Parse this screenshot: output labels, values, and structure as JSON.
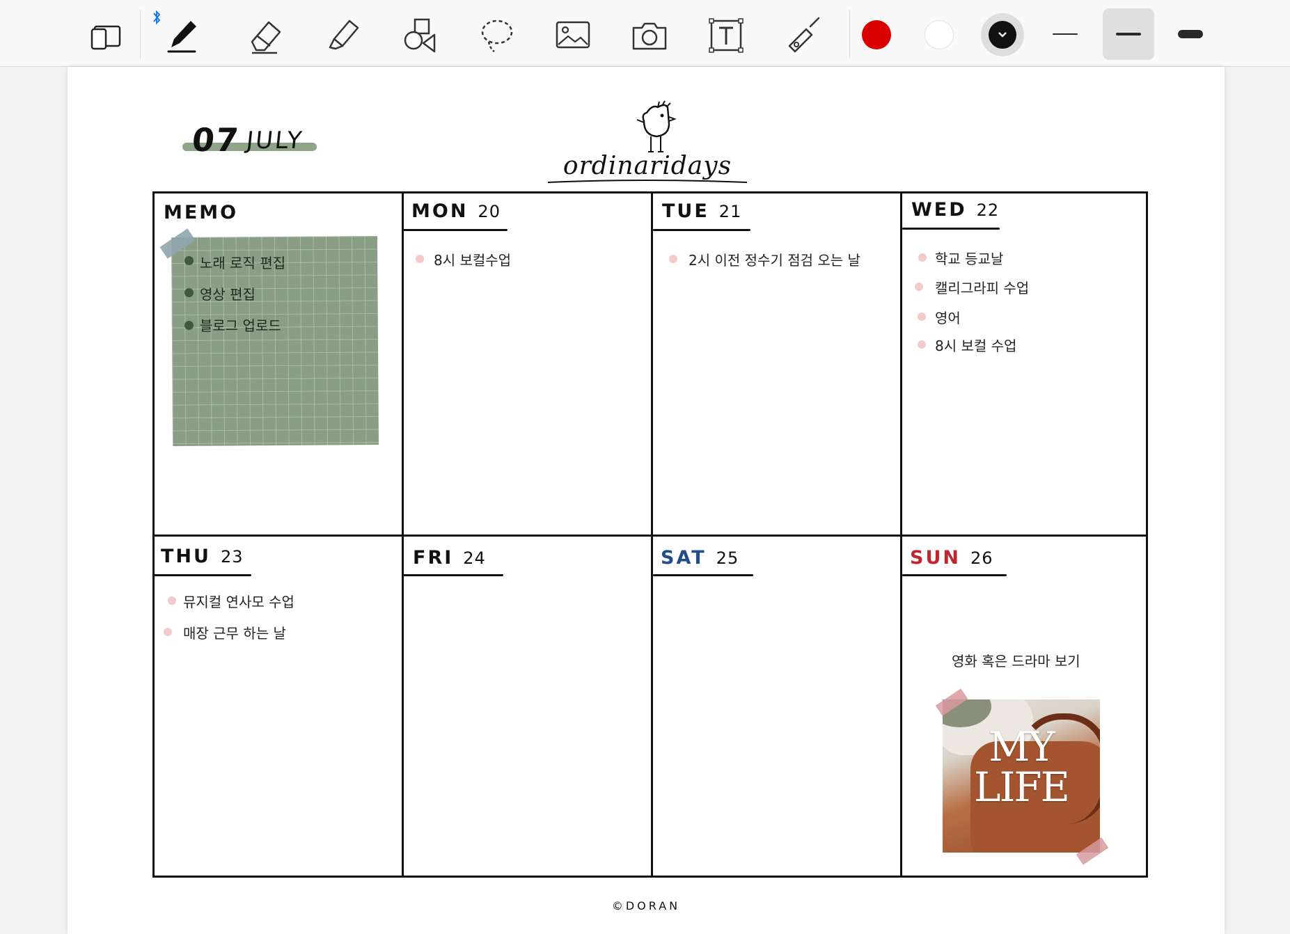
{
  "toolbar": {
    "tools": [
      {
        "id": "page-layout",
        "icon": "page-layout-icon"
      },
      {
        "id": "pen",
        "icon": "pen-icon"
      },
      {
        "id": "eraser",
        "icon": "eraser-icon"
      },
      {
        "id": "highlighter",
        "icon": "highlighter-icon"
      },
      {
        "id": "shapes",
        "icon": "shapes-icon"
      },
      {
        "id": "lasso",
        "icon": "lasso-icon"
      },
      {
        "id": "image",
        "icon": "image-icon"
      },
      {
        "id": "camera",
        "icon": "camera-icon"
      },
      {
        "id": "text",
        "icon": "text-box-icon"
      },
      {
        "id": "laser",
        "icon": "laser-pointer-icon"
      }
    ],
    "colors": [
      "#d90000",
      "#ffffff",
      "#111111"
    ],
    "selected_color": "#111111",
    "stroke_widths": [
      "thin",
      "medium",
      "thick"
    ],
    "selected_stroke": "medium"
  },
  "planner": {
    "date_number": "07",
    "date_month": "JULY",
    "brand": "ordinaridays",
    "credit": "©DORAN",
    "accent_color": "#8fa588",
    "memo": {
      "title": "MEMO",
      "items": [
        "노래 로직 편집",
        "영상 편집",
        "블로그 업로드"
      ]
    },
    "days": [
      {
        "key": "mon",
        "name": "MON",
        "num": "20",
        "color": "#111111",
        "tasks": [
          "8시 보컬수업"
        ]
      },
      {
        "key": "tue",
        "name": "TUE",
        "num": "21",
        "color": "#111111",
        "tasks": [
          "2시 이전 정수기 점검 오는 날"
        ]
      },
      {
        "key": "wed",
        "name": "WED",
        "num": "22",
        "color": "#111111",
        "tasks": [
          "학교 등교날",
          "캘리그라피 수업",
          "영어",
          "8시 보컬 수업"
        ]
      },
      {
        "key": "thu",
        "name": "THU",
        "num": "23",
        "color": "#111111",
        "tasks": [
          "뮤지컬 연사모 수업",
          "매장 근무 하는 날"
        ]
      },
      {
        "key": "fri",
        "name": "FRI",
        "num": "24",
        "color": "#111111",
        "tasks": []
      },
      {
        "key": "sat",
        "name": "SAT",
        "num": "25",
        "color": "#1f4f86",
        "tasks": []
      },
      {
        "key": "sun",
        "name": "SUN",
        "num": "26",
        "color": "#c0262d",
        "tasks": [
          "영화 혹은 드라마 보기"
        ]
      }
    ],
    "photo_text": [
      "MY",
      "LIFE"
    ]
  }
}
